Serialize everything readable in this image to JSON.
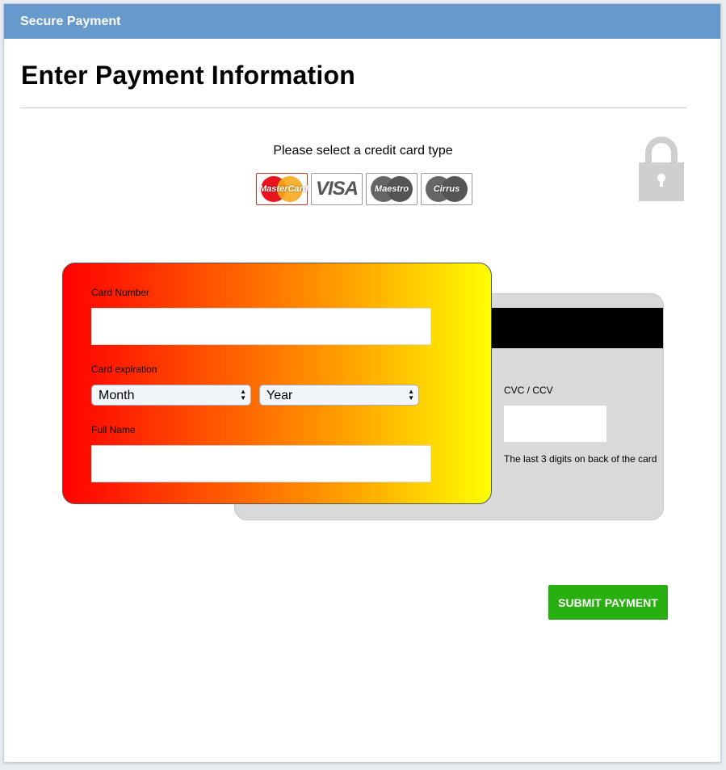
{
  "header": {
    "title": "Secure Payment"
  },
  "page": {
    "title": "Enter Payment Information"
  },
  "card_type": {
    "prompt": "Please select a credit card type",
    "options": [
      {
        "label": "MasterCard",
        "icon": "mastercard-logo",
        "selected": true
      },
      {
        "label": "VISA",
        "icon": "visa-logo",
        "selected": false
      },
      {
        "label": "Maestro",
        "icon": "maestro-logo",
        "selected": false
      },
      {
        "label": "Cirrus",
        "icon": "cirrus-logo",
        "selected": false
      }
    ]
  },
  "lock_icon": "lock-icon",
  "card_front": {
    "number_label": "Card Number",
    "number_value": "",
    "expiration_label": "Card expiration",
    "month_value": "Month",
    "year_value": "Year",
    "name_label": "Full Name",
    "name_value": "",
    "gradient_start": "#ff0000",
    "gradient_end": "#ffff00"
  },
  "card_back": {
    "cvc_label": "CVC / CCV",
    "cvc_value": "",
    "cvc_help": "The last 3 digits on back of the card"
  },
  "submit": {
    "label": "SUBMIT PAYMENT",
    "color": "#27b00f"
  },
  "colors": {
    "header": "#6699cc",
    "accent": "#27b00f"
  }
}
